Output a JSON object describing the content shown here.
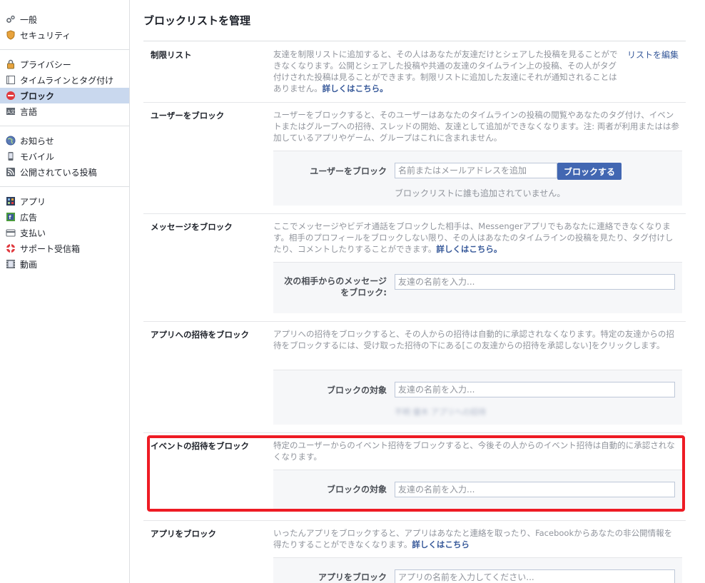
{
  "sidebar": {
    "groups": [
      [
        {
          "label": "一般",
          "icon": "gears-icon"
        },
        {
          "label": "セキュリティ",
          "icon": "shield-icon"
        }
      ],
      [
        {
          "label": "プライバシー",
          "icon": "lock-icon"
        },
        {
          "label": "タイムラインとタグ付け",
          "icon": "timeline-icon"
        },
        {
          "label": "ブロック",
          "icon": "block-icon",
          "active": true
        },
        {
          "label": "言語",
          "icon": "language-icon"
        }
      ],
      [
        {
          "label": "お知らせ",
          "icon": "globe-icon"
        },
        {
          "label": "モバイル",
          "icon": "phone-icon"
        },
        {
          "label": "公開されている投稿",
          "icon": "rss-icon"
        }
      ],
      [
        {
          "label": "アプリ",
          "icon": "apps-icon"
        },
        {
          "label": "広告",
          "icon": "ads-icon"
        },
        {
          "label": "支払い",
          "icon": "card-icon"
        },
        {
          "label": "サポート受信箱",
          "icon": "lifebuoy-icon"
        },
        {
          "label": "動画",
          "icon": "film-icon"
        }
      ]
    ]
  },
  "page": {
    "title": "ブロックリストを管理"
  },
  "sections": {
    "restricted": {
      "label": "制限リスト",
      "desc": "友達を制限リストに追加すると、その人はあなたが友達だけとシェアした投稿を見ることができなくなります。公開とシェアした投稿や共通の友達のタイムライン上の投稿、その人がタグ付けされた投稿は見ることができます。制限リストに追加した友達にそれが通知されることはありません。",
      "learn_more": "詳しくはこちら。",
      "edit_link": "リストを編集"
    },
    "block_users": {
      "label": "ユーザーをブロック",
      "desc": "ユーザーをブロックすると、そのユーザーはあなたのタイムラインの投稿の閲覧やあなたのタグ付け、イベントまたはグループへの招待、スレッドの開始、友達として追加ができなくなります。注: 両者が利用またはは参加しているアプリやゲーム、グループはこれに含まれません。",
      "field_label": "ユーザーをブロック",
      "placeholder": "名前またはメールアドレスを追加",
      "button": "ブロックする",
      "note": "ブロックリストに誰も追加されていません。"
    },
    "block_messages": {
      "label": "メッセージをブロック",
      "desc": "ここでメッセージやビデオ通話をブロックした相手は、Messengerアプリでもあなたに連絡できなくなります。相手のプロフィールをブロックしない限り、その人はあなたのタイムラインの投稿を見たり、タグ付けしたり、コメントしたりすることができます。",
      "learn_more": "詳しくはこちら。",
      "field_label_line1": "次の相手からのメッセージ",
      "field_label_line2": "をブロック:",
      "placeholder": "友達の名前を入力..."
    },
    "block_app_invites": {
      "label": "アプリへの招待をブロック",
      "desc": "アプリへの招待をブロックすると、その人からの招待は自動的に承認されなくなります。特定の友達からの招待をブロックするには、受け取った招待の下にある[この友達からの招待を承認しない]をクリックします。",
      "field_label": "ブロックの対象",
      "placeholder": "友達の名前を入力...",
      "blurred_note": "不明 優木 アプリへの招待"
    },
    "block_event_invites": {
      "label": "イベントの招待をブロック",
      "desc": "特定のユーザーからのイベント招待をブロックすると、今後その人からのイベント招待は自動的に承認されなくなります。",
      "field_label": "ブロックの対象",
      "placeholder": "友達の名前を入力..."
    },
    "block_apps": {
      "label": "アプリをブロック",
      "desc": "いったんアプリをブロックすると、アプリはあなたと連絡を取ったり、Facebookからあなたの非公開情報を得たりすることができなくなります。",
      "learn_more": "詳しくはこちら",
      "field_label": "アプリをブロック",
      "placeholder": "アプリの名前を入力してください..."
    }
  },
  "colors": {
    "highlight": "#ee1b24",
    "link": "#365899",
    "button": "#4267b2",
    "active_bg": "#c9d8ee"
  }
}
